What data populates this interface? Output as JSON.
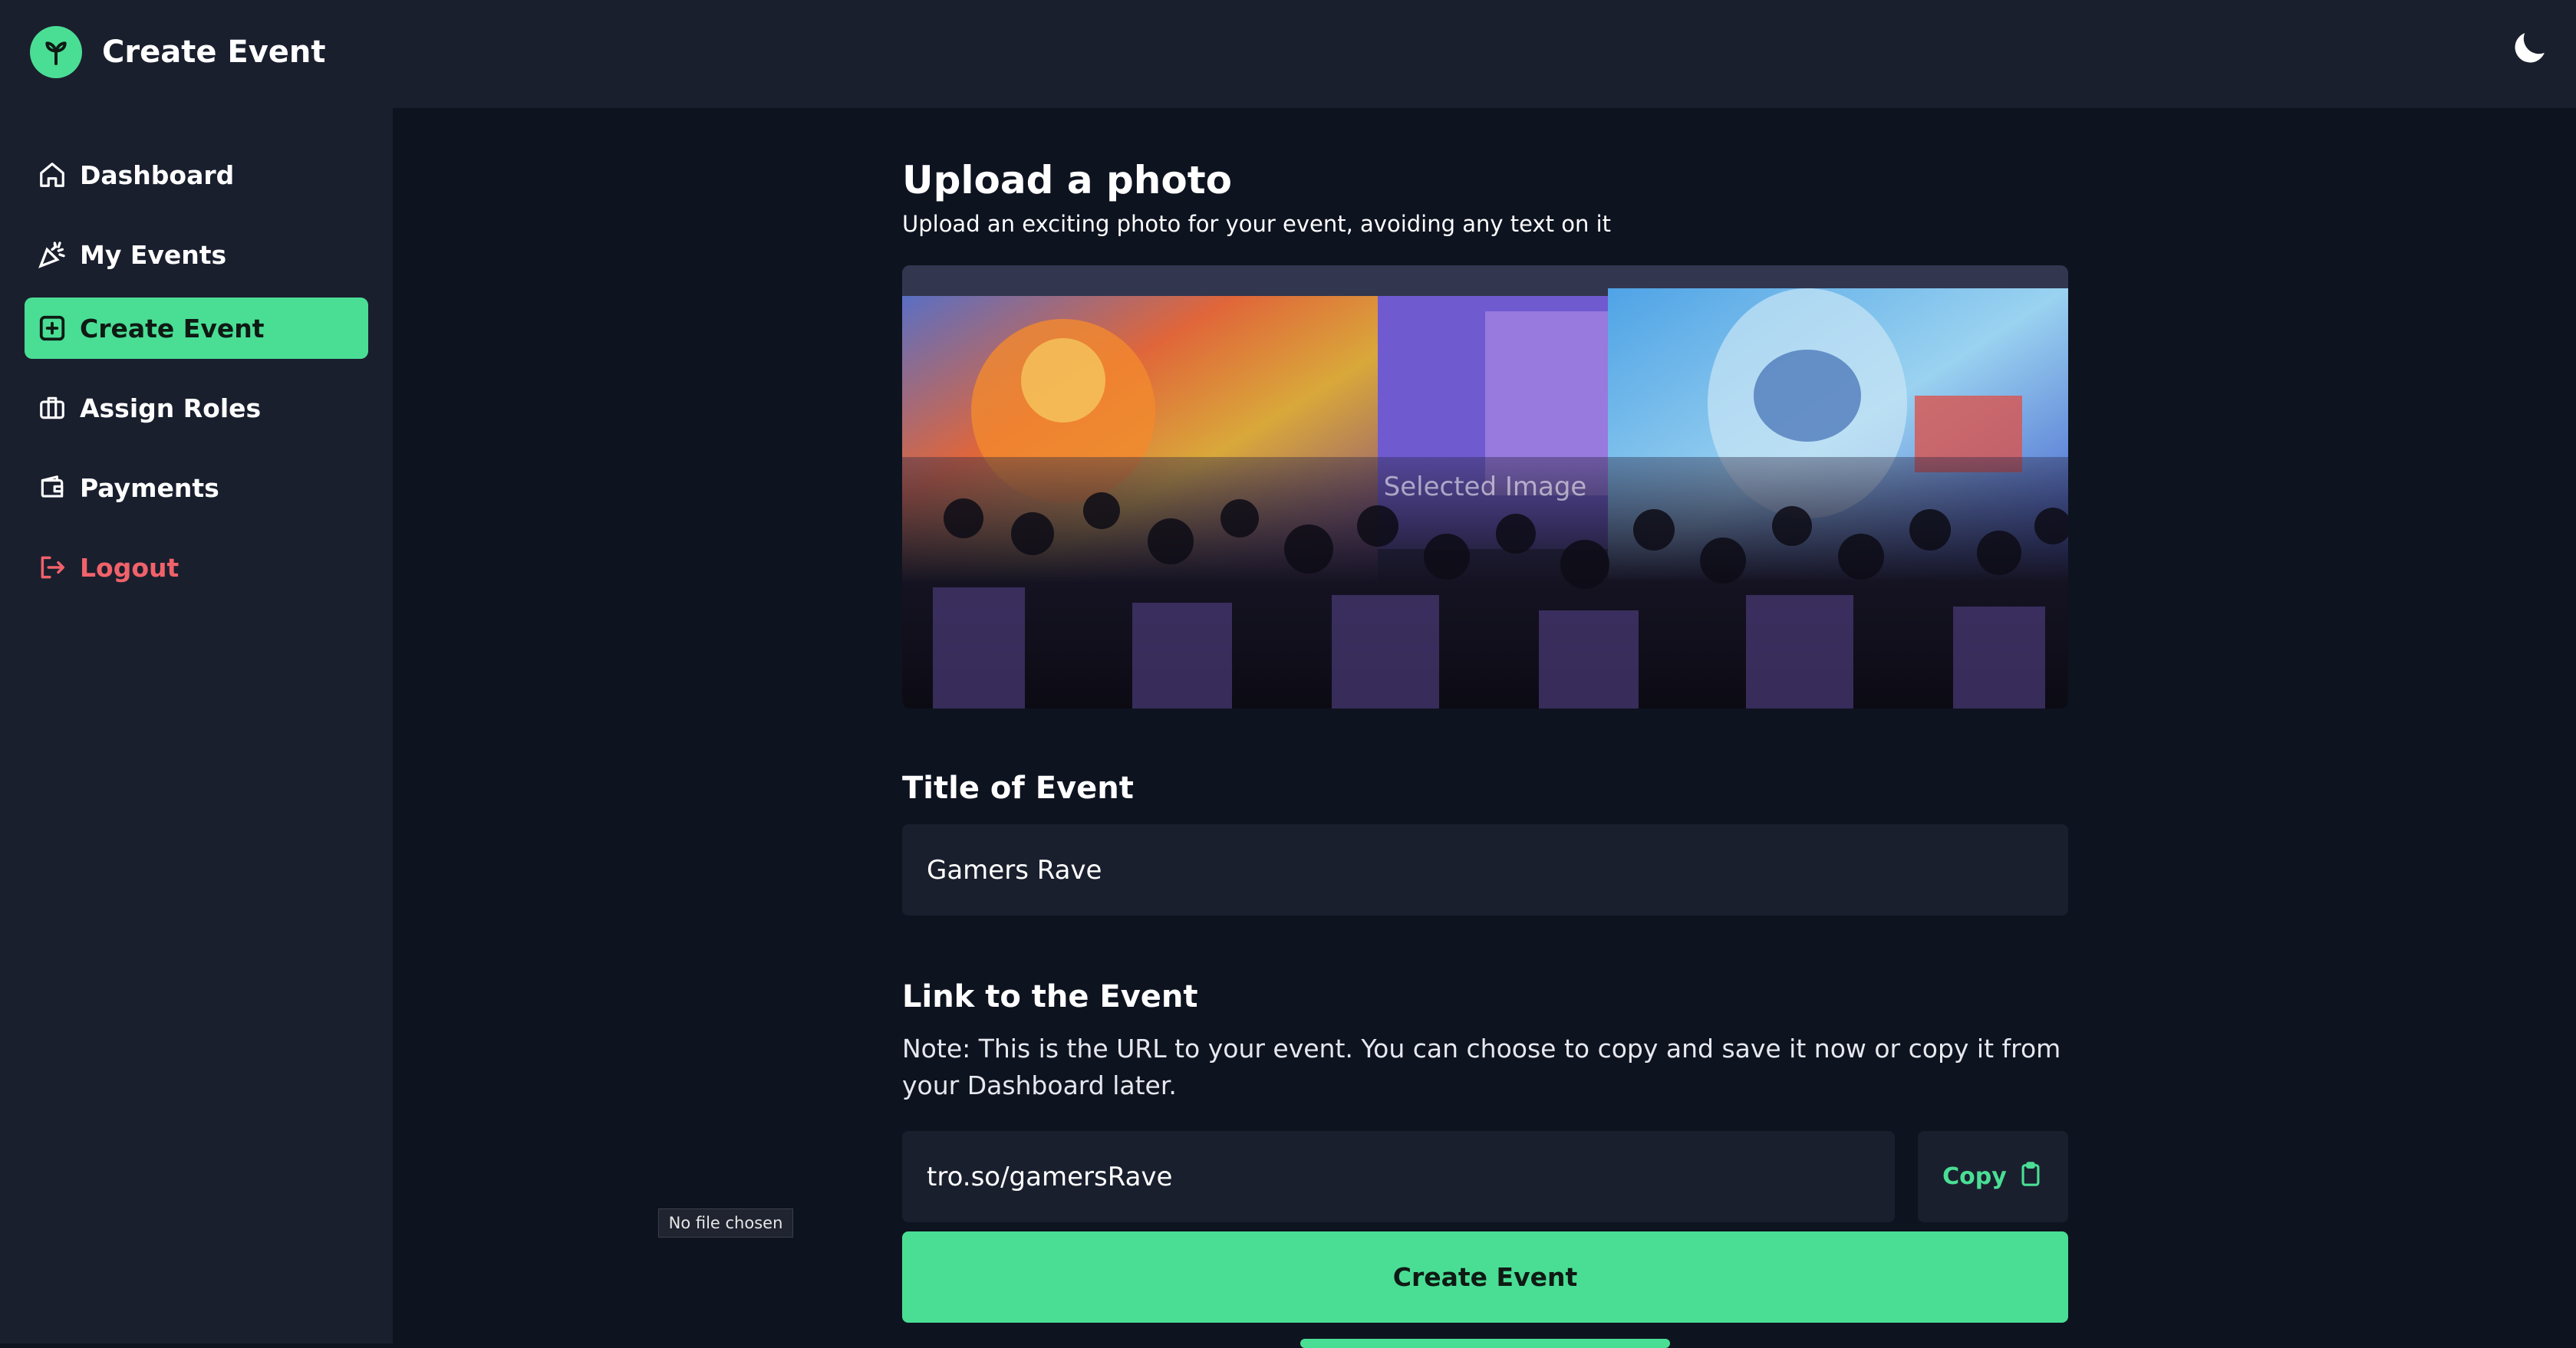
{
  "app": {
    "title": "Create Event",
    "accent_color": "#4ade95",
    "logo_icon": "sprout-icon",
    "theme_icon": "moon-icon"
  },
  "sidebar": {
    "items": [
      {
        "label": "Dashboard",
        "icon": "home-icon",
        "active": false
      },
      {
        "label": "My Events",
        "icon": "party-popper-icon",
        "active": false
      },
      {
        "label": "Create Event",
        "icon": "plus-square-icon",
        "active": true
      },
      {
        "label": "Assign Roles",
        "icon": "briefcase-icon",
        "active": false
      },
      {
        "label": "Payments",
        "icon": "wallet-icon",
        "active": false
      },
      {
        "label": "Logout",
        "icon": "logout-icon",
        "active": false,
        "color": "#f0626a"
      }
    ]
  },
  "upload": {
    "heading": "Upload a photo",
    "subtitle": "Upload an exciting photo for your event, avoiding any text on it",
    "image_alt": "Selected Image",
    "file_status": "No file chosen"
  },
  "title_section": {
    "heading": "Title of Event",
    "value": "Gamers Rave"
  },
  "link_section": {
    "heading": "Link to the Event",
    "note": "Note: This is the URL to your event. You can choose to copy and save it now or copy it from your Dashboard later.",
    "value": "tro.so/gamersRave",
    "copy_label": "Copy",
    "copy_icon": "clipboard-icon"
  },
  "actions": {
    "create_label": "Create Event"
  }
}
